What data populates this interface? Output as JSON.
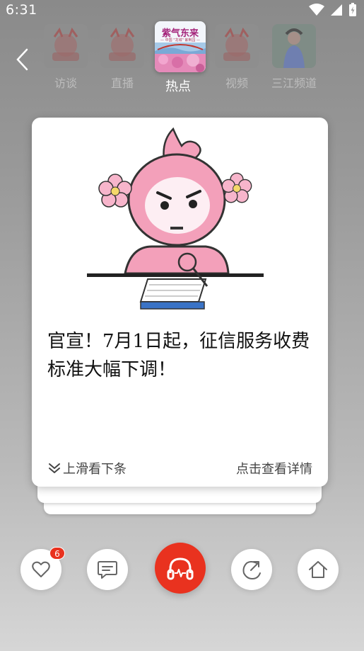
{
  "status_bar": {
    "time": "6:31"
  },
  "channels": [
    {
      "label": "访谈",
      "active": false
    },
    {
      "label": "直播",
      "active": false
    },
    {
      "label": "热点",
      "active": true,
      "thumb_text": "紫气东来",
      "thumb_subtext": "— 中国 \"龙城\" 紫荆园 —"
    },
    {
      "label": "视频",
      "active": false
    },
    {
      "label": "三江频道",
      "active": false
    }
  ],
  "card": {
    "title": "官宣！7月1日起，征信服务收费标准大幅下调！",
    "swipe_hint": "上滑看下条",
    "detail_link": "点击查看详情"
  },
  "actions": {
    "like_count": "6"
  },
  "colors": {
    "accent": "#e9321f",
    "mascot_pink": "#f3a0ba"
  }
}
